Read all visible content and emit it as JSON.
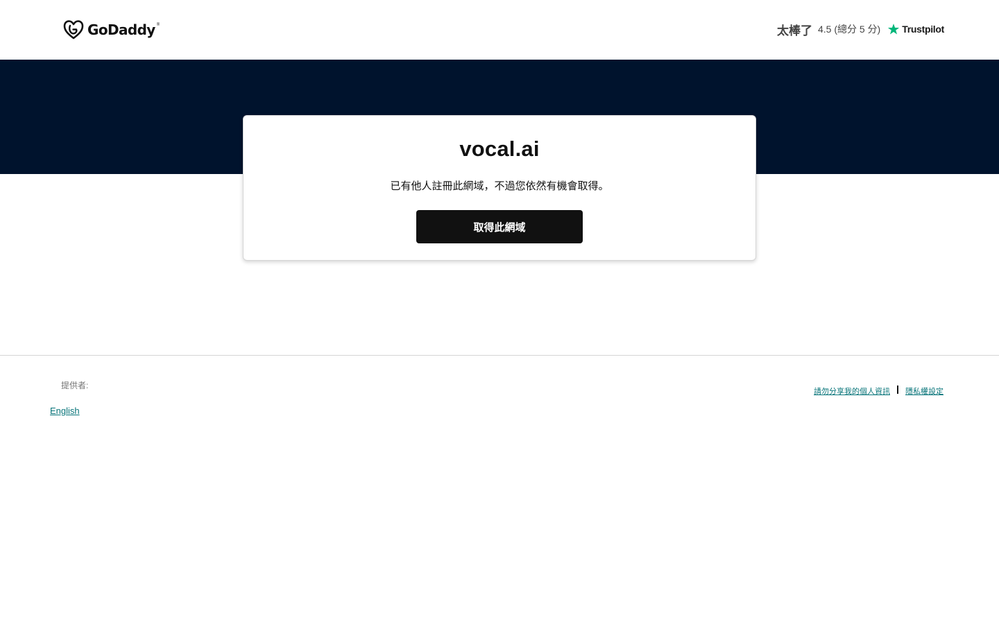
{
  "header": {
    "logo": {
      "icon": "godaddy-heart-icon",
      "text": "GoDaddy",
      "trademark": "®"
    },
    "rating": {
      "word": "太棒了",
      "score_text": "4.5 (總分 5 分)",
      "provider_icon": "trustpilot-star-icon",
      "provider": "Trustpilot",
      "score": 4.5,
      "max": 5
    }
  },
  "hero": {
    "background_color": "#00132d"
  },
  "card": {
    "domain": "vocal.ai",
    "message": "已有他人註冊此網域，不過您依然有機會取得。",
    "button_label": "取得此網域"
  },
  "footer": {
    "provided_by": "提供者:",
    "language_link": "English",
    "links": [
      "請勿分享我的個人資訊",
      "隱私權設定"
    ],
    "separator": "|",
    "link_color": "#09757a"
  },
  "colors": {
    "accent_trustpilot": "#00b67a",
    "button": "#111111"
  }
}
